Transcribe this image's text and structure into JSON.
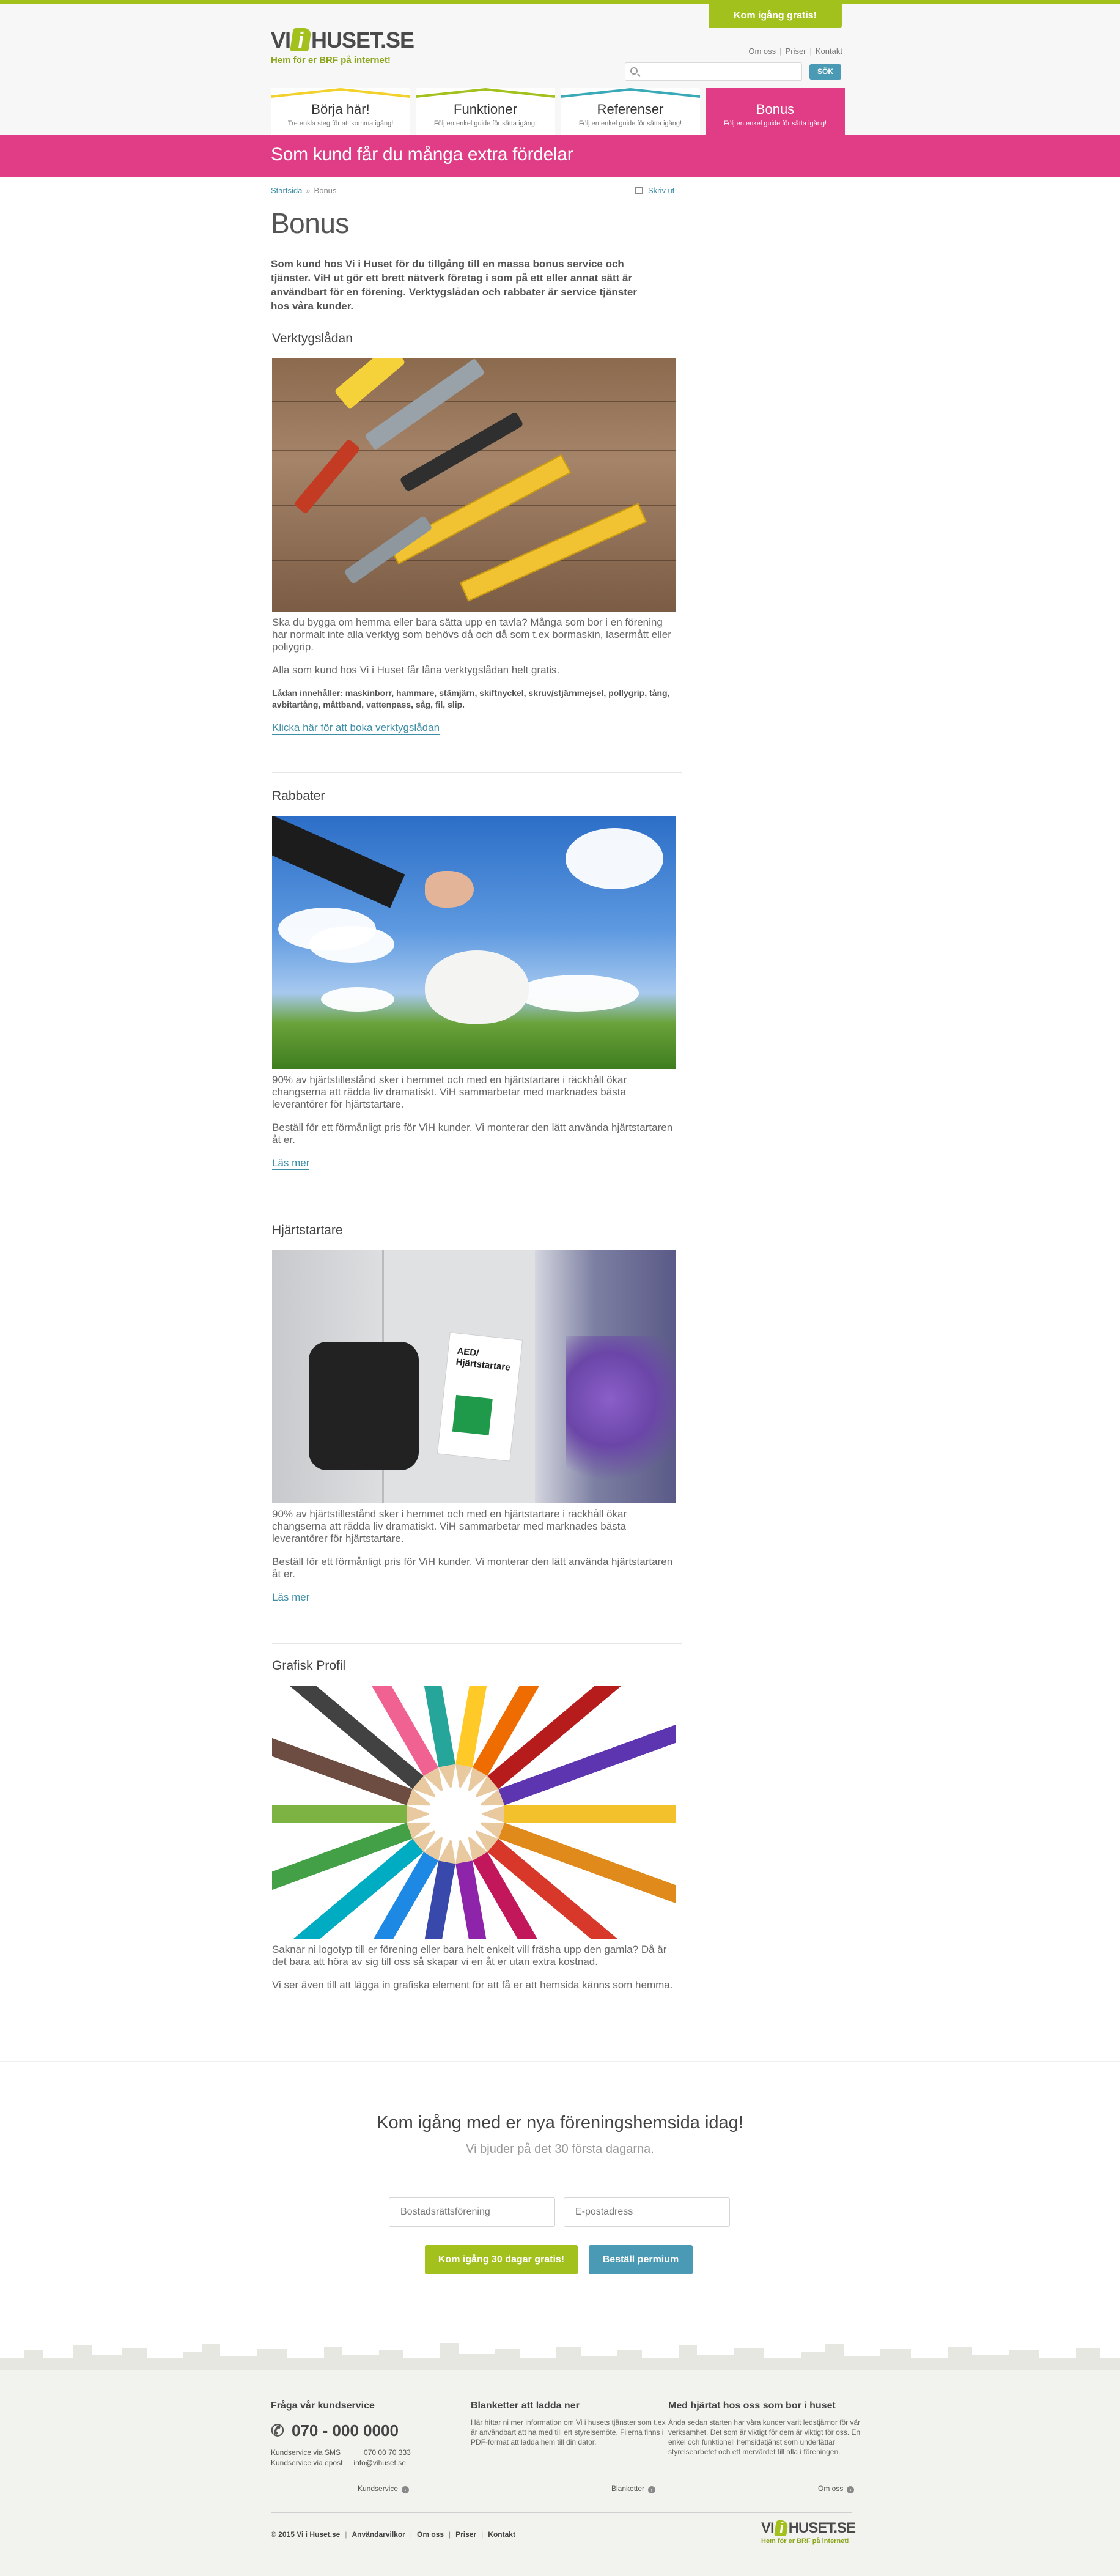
{
  "top_cta": "Kom igång gratis!",
  "logo": {
    "part1": "VI",
    "letter": "i",
    "part2": "HUSET.SE",
    "tagline": "Hem för er BRF på internet!"
  },
  "toplinks": [
    "Om oss",
    "Priser",
    "Kontakt"
  ],
  "search": {
    "placeholder": "",
    "button": "SÖK"
  },
  "nav": [
    {
      "title": "Börja här!",
      "sub": "Tre enkla steg för att komma igång!",
      "color": "#f2d12c"
    },
    {
      "title": "Funktioner",
      "sub": "Följ en enkel guide för sätta igång!",
      "color": "#a2c11c"
    },
    {
      "title": "Referenser",
      "sub": "Följ en enkel guide för sätta igång!",
      "color": "#3aa9b8"
    },
    {
      "title": "Bonus",
      "sub": "Följ en enkel guide för sätta igång!",
      "color": "#e03d86"
    }
  ],
  "banner_title": "Som kund får du många extra fördelar",
  "breadcrumb": {
    "home": "Startsida",
    "separator": "»",
    "current": "Bonus"
  },
  "print_label": "Skriv ut",
  "page_title": "Bonus",
  "lead": "Som kund hos Vi i Huset för du tillgång till en massa bonus service och tjänster. ViH ut gör ett brett nätverk företag i som på ett eller annat sätt är användbart för en förening. Verktygslådan och rabbater är service tjänster hos våra kunder.",
  "sections": [
    {
      "title": "Verktygslådan",
      "text1": "Ska du bygga om hemma eller bara sätta upp en tavla? Många som bor i en förening har normalt inte alla verktyg som behövs då och då som t.ex bormaskin, lasermått eller poliygrip.",
      "text2": "Alla som kund hos Vi i Huset får låna verktygslådan helt gratis.",
      "bold": "Lådan innehåller: maskinborr, hammare, stämjärn, skiftnyckel, skruv/stjärnmejsel, pollygrip, tång, avbitartång, måttband, vattenpass, såg, fil, slip.",
      "link": "Klicka här för att boka verktygslådan"
    },
    {
      "title": "Rabbater",
      "text1": "90% av hjärtstillestånd sker i hemmet och med en hjärtstartare i räckhåll ökar changserna att rädda liv dramatiskt. ViH sammarbetar med marknades bästa leverantörer för hjärtstartare.",
      "text2": "Beställ för ett förmånligt pris för ViH kunder. Vi monterar den lätt använda hjärtstartaren åt er.",
      "link": "Läs mer"
    },
    {
      "title": "Hjärtstartare",
      "text1": "90% av hjärtstillestånd sker i hemmet och med en hjärtstartare i räckhåll ökar changserna att rädda liv dramatiskt. ViH sammarbetar med marknades bästa leverantörer för hjärtstartare.",
      "text2": "Beställ för ett förmånligt pris för ViH kunder. Vi monterar den lätt använda hjärtstartaren åt er.",
      "link": "Läs mer",
      "sign_text": "AED/ Hjärtstartare"
    },
    {
      "title": "Grafisk Profil",
      "text1": "Saknar ni logotyp till er förening eller bara helt enkelt vill fräsha upp den gamla? Då är det bara att höra av sig till oss så skapar vi en åt er utan extra kostnad.",
      "text2": "Vi ser även till att lägga in grafiska element för att få er att hemsida känns som hemma."
    }
  ],
  "cta": {
    "title": "Kom igång med er nya föreningshemsida idag!",
    "sub": "Vi bjuder på det 30 första dagarna.",
    "input1_placeholder": "Bostadsrättsförening",
    "input2_placeholder": "E-postadress",
    "btn1": "Kom igång 30 dagar gratis!",
    "btn2": "Beställ permium"
  },
  "footer": {
    "col1": {
      "title": "Fråga vår kundservice",
      "phone": "070 - 000 0000",
      "sms_label": "Kundservice via SMS",
      "sms_value": "070 00 70 333",
      "email_label": "Kundservice via epost",
      "email_value": "info@vihuset.se",
      "link": "Kundservice"
    },
    "col2": {
      "title": "Blanketter att ladda ner",
      "text": "Här hittar ni mer information om Vi i husets tjänster som t.ex är användbart att ha med till ert styrelsemöte. Filerna finns i PDF-format att ladda hem till din dator.",
      "link": "Blanketter"
    },
    "col3": {
      "title": "Med hjärtat hos oss som bor i huset",
      "text": "Ända sedan starten har våra kunder varit ledstjärnor för vår verksamhet. Det som är viktigt för dem är viktigt för oss. En enkel och funktionell hemsidatjänst som underlättar styrelsearbetet och ett mervärdet till alla i föreningen.",
      "link": "Om oss"
    },
    "bottom_links": [
      "© 2015 Vi i Huset.se",
      "Användarvilkor",
      "Om oss",
      "Priser",
      "Kontakt"
    ]
  }
}
